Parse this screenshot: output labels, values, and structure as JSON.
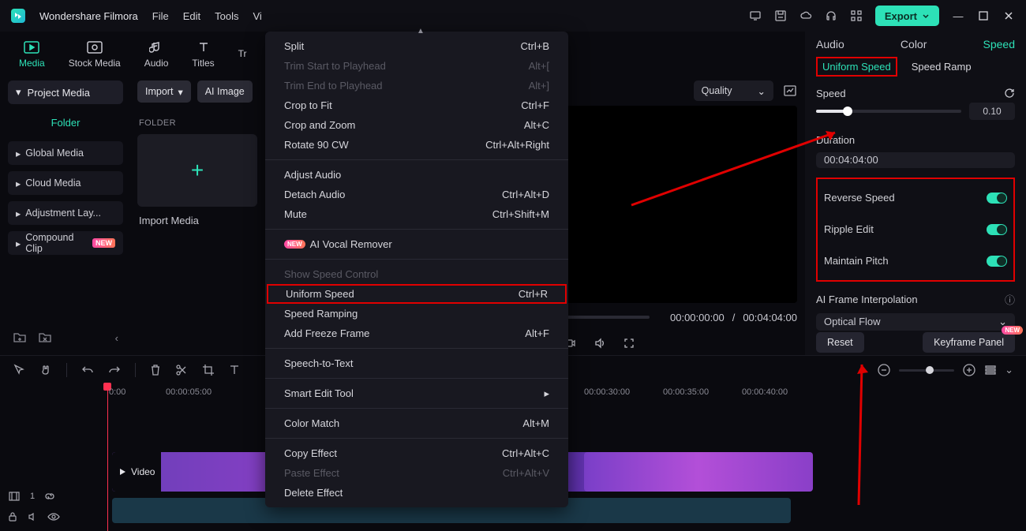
{
  "app": {
    "title": "Wondershare Filmora"
  },
  "menus": [
    "File",
    "Edit",
    "Tools",
    "Vi"
  ],
  "export": "Export",
  "tabs": [
    {
      "label": "Media",
      "active": true
    },
    {
      "label": "Stock Media"
    },
    {
      "label": "Audio"
    },
    {
      "label": "Titles"
    },
    {
      "label": "Tr"
    }
  ],
  "sidebar": {
    "project": "Project Media",
    "folder": "Folder",
    "items": [
      "Global Media",
      "Cloud Media",
      "Adjustment Lay...",
      "Compound Clip"
    ],
    "new": "NEW"
  },
  "center": {
    "import": "Import",
    "ai": "AI Image",
    "folder_h": "FOLDER",
    "import_media": "Import Media"
  },
  "preview": {
    "quality": "Quality",
    "cur": "00:00:00:00",
    "sep": "/",
    "dur": "00:04:04:00"
  },
  "panel": {
    "tabs": [
      "Audio",
      "Color",
      "Speed"
    ],
    "subtabs": [
      "Uniform Speed",
      "Speed Ramp"
    ],
    "speed_l": "Speed",
    "speed_v": "0.10",
    "dur_l": "Duration",
    "dur_v": "00:04:04:00",
    "rev": "Reverse Speed",
    "rip": "Ripple Edit",
    "pit": "Maintain Pitch",
    "ai_l": "AI Frame Interpolation",
    "ai_v": "Optical Flow",
    "reset": "Reset",
    "kf": "Keyframe Panel",
    "new": "NEW"
  },
  "ctx": {
    "split": {
      "l": "Split",
      "s": "Ctrl+B"
    },
    "ts": {
      "l": "Trim Start to Playhead",
      "s": "Alt+["
    },
    "te": {
      "l": "Trim End to Playhead",
      "s": "Alt+]"
    },
    "cf": {
      "l": "Crop to Fit",
      "s": "Ctrl+F"
    },
    "cz": {
      "l": "Crop and Zoom",
      "s": "Alt+C"
    },
    "rot": {
      "l": "Rotate 90 CW",
      "s": "Ctrl+Alt+Right"
    },
    "aa": {
      "l": "Adjust Audio",
      "s": ""
    },
    "da": {
      "l": "Detach Audio",
      "s": "Ctrl+Alt+D"
    },
    "mu": {
      "l": "Mute",
      "s": "Ctrl+Shift+M"
    },
    "vr": {
      "l": "AI Vocal Remover",
      "s": ""
    },
    "ssc": {
      "l": "Show Speed Control",
      "s": ""
    },
    "us": {
      "l": "Uniform Speed",
      "s": "Ctrl+R"
    },
    "sr": {
      "l": "Speed Ramping",
      "s": ""
    },
    "ff": {
      "l": "Add Freeze Frame",
      "s": "Alt+F"
    },
    "stt": {
      "l": "Speech-to-Text",
      "s": ""
    },
    "set": {
      "l": "Smart Edit Tool",
      "s": ""
    },
    "cm": {
      "l": "Color Match",
      "s": "Alt+M"
    },
    "ce": {
      "l": "Copy Effect",
      "s": "Ctrl+Alt+C"
    },
    "pe": {
      "l": "Paste Effect",
      "s": "Ctrl+Alt+V"
    },
    "de": {
      "l": "Delete Effect",
      "s": ""
    }
  },
  "ruler": [
    "0:00",
    "00:00:05:00",
    "00:00:30:00",
    "00:00:35:00",
    "00:00:40:00"
  ],
  "video_label": "Video"
}
